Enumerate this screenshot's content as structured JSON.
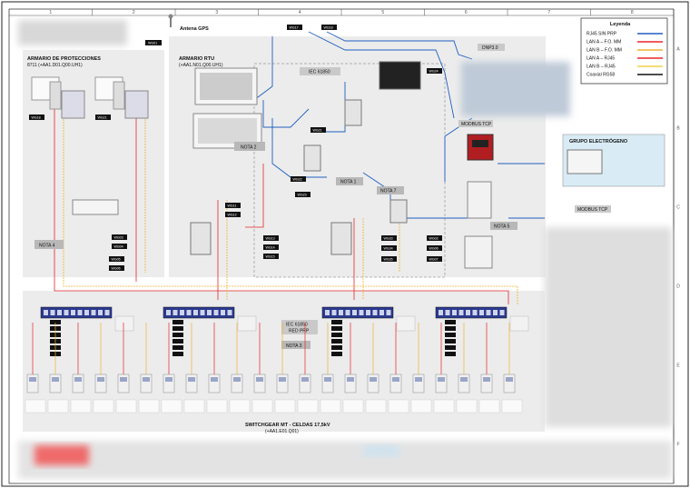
{
  "grid": {
    "columns": [
      "1",
      "2",
      "3",
      "4",
      "5",
      "6",
      "7",
      "8"
    ],
    "rows": [
      "A",
      "B",
      "C",
      "D",
      "E",
      "F"
    ]
  },
  "header": {
    "antenna_label": "Antena GPS",
    "tag_gps": "WG01"
  },
  "legend": {
    "title": "Leyenda",
    "items": [
      {
        "label": "RJ45 SIN PRP",
        "color": "#1f5fbf"
      },
      {
        "label": "LAN A – F.O. MM",
        "color": "#e8262a"
      },
      {
        "label": "LAN B – F.O. MM",
        "color": "#f2b134"
      },
      {
        "label": "LAN A – RJ45",
        "color": "#e8262a"
      },
      {
        "label": "LAN B – RJ45",
        "color": "#f2d04a"
      },
      {
        "label": "Coaxial RG58",
        "color": "#111111"
      }
    ]
  },
  "cabinets": {
    "protecciones": {
      "title": "ARMARIO DE PROTECCIONES",
      "subtitle": "8711 (+AA1.D01.Q00.UH1)"
    },
    "rtu": {
      "title": "ARMARIO RTU",
      "subtitle": "(+AA1.N01.Q00.UH1)"
    },
    "switchgear": {
      "title": "SWITCHGEAR MT - CELDAS 17,5kV",
      "subtitle": "(+AA1.E01.Q01)"
    }
  },
  "notes": {
    "nota1": "NOTA 1",
    "nota2": "NOTA 2",
    "nota3": "NOTA 3",
    "nota4": "NOTA 4",
    "nota5": "NOTA 5",
    "nota7": "NOTA 7"
  },
  "labels": {
    "iec_top": "IEC 61850",
    "iec_bottom": "IEC 61850",
    "red_prp": "RED PRP",
    "dnp": "DNP3.0",
    "modbus_tcp_1": "MODBUS TCP",
    "modbus_tcp_2": "MODBUS TCP",
    "grupo": "GRUPO ELECTRÓGENO"
  },
  "tags": {
    "wg_top": [
      "WG17",
      "WG18"
    ],
    "wg_prot": [
      "WG18",
      "WG21"
    ],
    "wg_mid": [
      "WG24",
      "WG21",
      "WG22",
      "WG23"
    ],
    "wg_left": [
      "WG03",
      "WG04",
      "WG05",
      "WG06"
    ],
    "wg_center": [
      "WG11",
      "WG12",
      "WG13",
      "WG14",
      "WG15"
    ],
    "wg_right": [
      "WG33",
      "WG34",
      "WG35"
    ],
    "wg_far": [
      "WG02",
      "WG06",
      "WG07"
    ]
  }
}
